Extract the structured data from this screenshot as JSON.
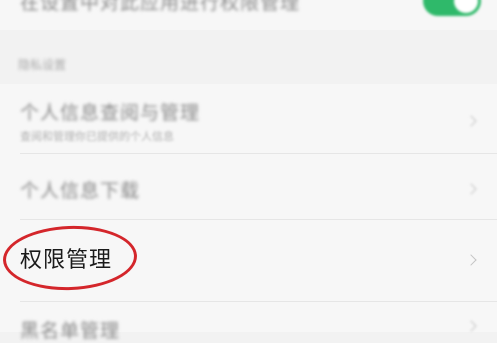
{
  "top_row": {
    "label": "在设置中对此应用进行权限管理"
  },
  "section": {
    "label": "隐私设置"
  },
  "items": [
    {
      "title": "个人信息查阅与管理",
      "subtitle": "查阅和管理你已提供的个人信息"
    },
    {
      "title": "个人信息下载"
    },
    {
      "title": "权限管理"
    },
    {
      "title": "黑名单管理"
    }
  ],
  "colors": {
    "accent": "#2fb96a",
    "annotation": "#d4262b"
  }
}
